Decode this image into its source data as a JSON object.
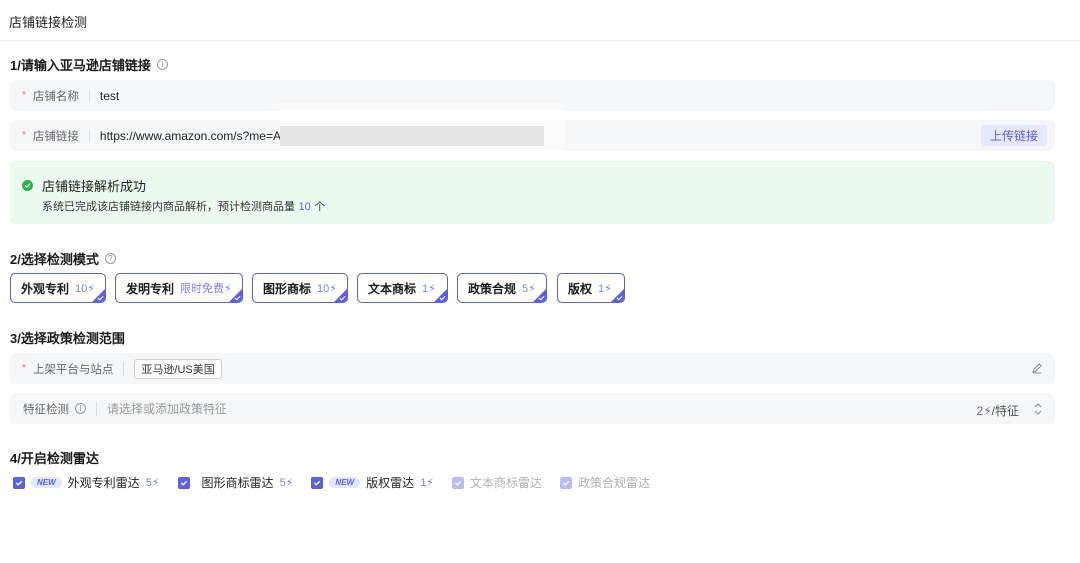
{
  "header": {
    "title": "店铺链接检测"
  },
  "step1": {
    "title": "1/请输入亚马逊店铺链接",
    "info_icon": "i",
    "store_name": {
      "required_mark": "*",
      "label": "店铺名称",
      "value": "test"
    },
    "store_link": {
      "required_mark": "*",
      "label": "店铺链接",
      "value": "https://www.amazon.com/s?me=A3E",
      "upload_label": "上传链接"
    },
    "success": {
      "title": "店铺链接解析成功",
      "desc_prefix": "系统已完成该店铺链接内商品解析，预计检测商品量",
      "count": "10",
      "desc_suffix": "个"
    }
  },
  "step2": {
    "title": "2/选择检测模式",
    "help_icon": "?",
    "modes": [
      {
        "name": "外观专利",
        "cost": "10"
      },
      {
        "name": "发明专利",
        "cost": "限时免费"
      },
      {
        "name": "图形商标",
        "cost": "10"
      },
      {
        "name": "文本商标",
        "cost": "1"
      },
      {
        "name": "政策合规",
        "cost": "5"
      },
      {
        "name": "版权",
        "cost": "1"
      }
    ]
  },
  "step3": {
    "title": "3/选择政策检测范围",
    "platform": {
      "required_mark": "*",
      "label": "上架平台与站点",
      "tag": "亚马逊/US美国"
    },
    "feature": {
      "label": "特征检测",
      "info_icon": "i",
      "placeholder": "请选择或添加政策特征",
      "cost": "2",
      "unit": "/特征"
    }
  },
  "step4": {
    "title": "4/开启检测雷达",
    "new_badge": "NEW",
    "radars": [
      {
        "name": "外观专利雷达",
        "cost": "5",
        "new": true,
        "disabled": false
      },
      {
        "name": "图形商标雷达",
        "cost": "5",
        "new": false,
        "disabled": false
      },
      {
        "name": "版权雷达",
        "cost": "1",
        "new": true,
        "disabled": false
      },
      {
        "name": "文本商标雷达",
        "cost": "",
        "new": false,
        "disabled": true
      },
      {
        "name": "政策合规雷达",
        "cost": "",
        "new": false,
        "disabled": true
      }
    ]
  },
  "icons": {
    "bolt": "⚡"
  },
  "colors": {
    "accent": "#5b5fe6",
    "success_bg": "#ebfaee",
    "success_icon": "#28b44a",
    "required": "#f26d6d"
  }
}
